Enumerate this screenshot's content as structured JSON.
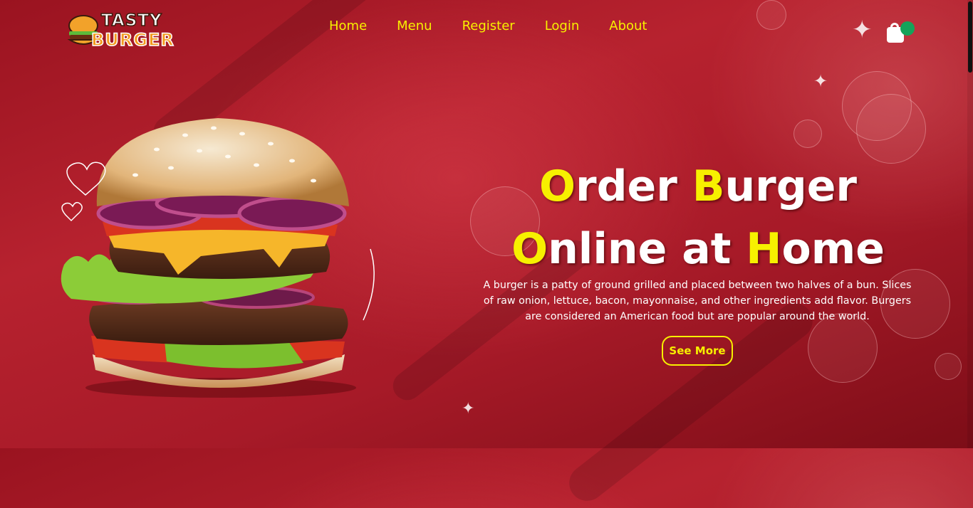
{
  "logo": {
    "word_top": "TASTY",
    "word_bottom": "BURGER"
  },
  "nav": {
    "items": [
      {
        "label": "Home"
      },
      {
        "label": "Menu"
      },
      {
        "label": "Register"
      },
      {
        "label": "Login"
      },
      {
        "label": "About"
      }
    ]
  },
  "cart": {
    "icon": "shopping-bag-icon",
    "badge_color": "#15a35a"
  },
  "hero": {
    "line1": {
      "cap1": "O",
      "rest1": "rder ",
      "cap2": "B",
      "rest2": "urger"
    },
    "line2": {
      "cap1": "O",
      "rest1": "nline at ",
      "cap2": "H",
      "rest2": "ome"
    },
    "description": "A burger is a patty of ground grilled and placed between two halves of a bun. Slices of raw onion, lettuce, bacon, mayonnaise, and other ingredients add flavor. Burgers are considered an American food but are popular around the world.",
    "button_label": "See More"
  },
  "colors": {
    "accent": "#f7f000",
    "background": "#a71a28",
    "text": "#ffffff"
  }
}
